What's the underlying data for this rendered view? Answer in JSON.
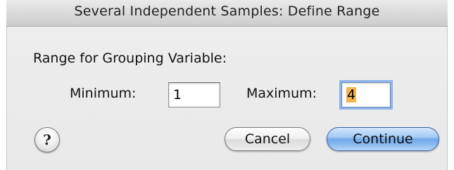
{
  "window": {
    "title": "Several Independent Samples: Define Range"
  },
  "range_section": {
    "label": "Range for Grouping Variable:"
  },
  "minimum": {
    "label": "Minimum:",
    "value": "1"
  },
  "maximum": {
    "label": "Maximum:",
    "value": "4"
  },
  "buttons": {
    "help_glyph": "?",
    "cancel_label": "Cancel",
    "continue_label": "Continue"
  },
  "colors": {
    "default_button": "#6fa7e8",
    "focus_ring": "#8fb4e8",
    "selection_highlight": "#f5b552"
  }
}
